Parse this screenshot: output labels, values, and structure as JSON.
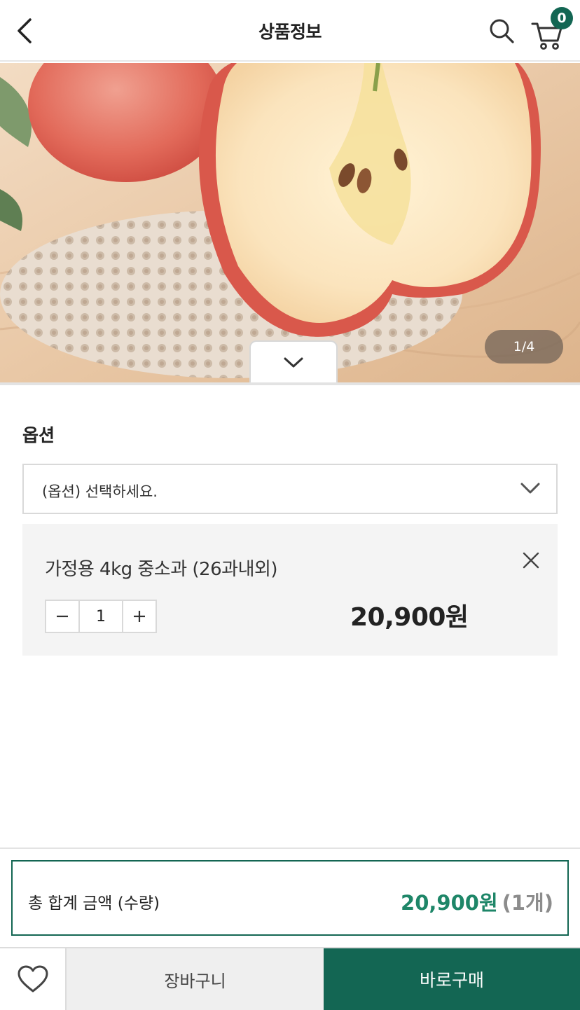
{
  "header": {
    "title": "상품정보",
    "back_icon": "chevron-left-icon",
    "search_icon": "search-icon",
    "cart_icon": "cart-icon",
    "cart_count": "0"
  },
  "gallery": {
    "image_subject": "halved red apple on crochet doily",
    "counter": "1/4",
    "collapse_icon": "chevron-down-icon"
  },
  "option": {
    "title": "옵션",
    "select_placeholder": "(옵션) 선택하세요.",
    "selected": {
      "name": "가정용 4kg 중소과 (26과내외)",
      "quantity": "1",
      "price": "20,900원"
    }
  },
  "total": {
    "label": "총 합계 금액 (수량)",
    "price": "20,900원",
    "quantity": "(1개)"
  },
  "actions": {
    "wish_icon": "heart-icon",
    "cart_label": "장바구니",
    "buy_label": "바로구매"
  },
  "colors": {
    "accent": "#136653",
    "price_accent": "#1e8668"
  }
}
